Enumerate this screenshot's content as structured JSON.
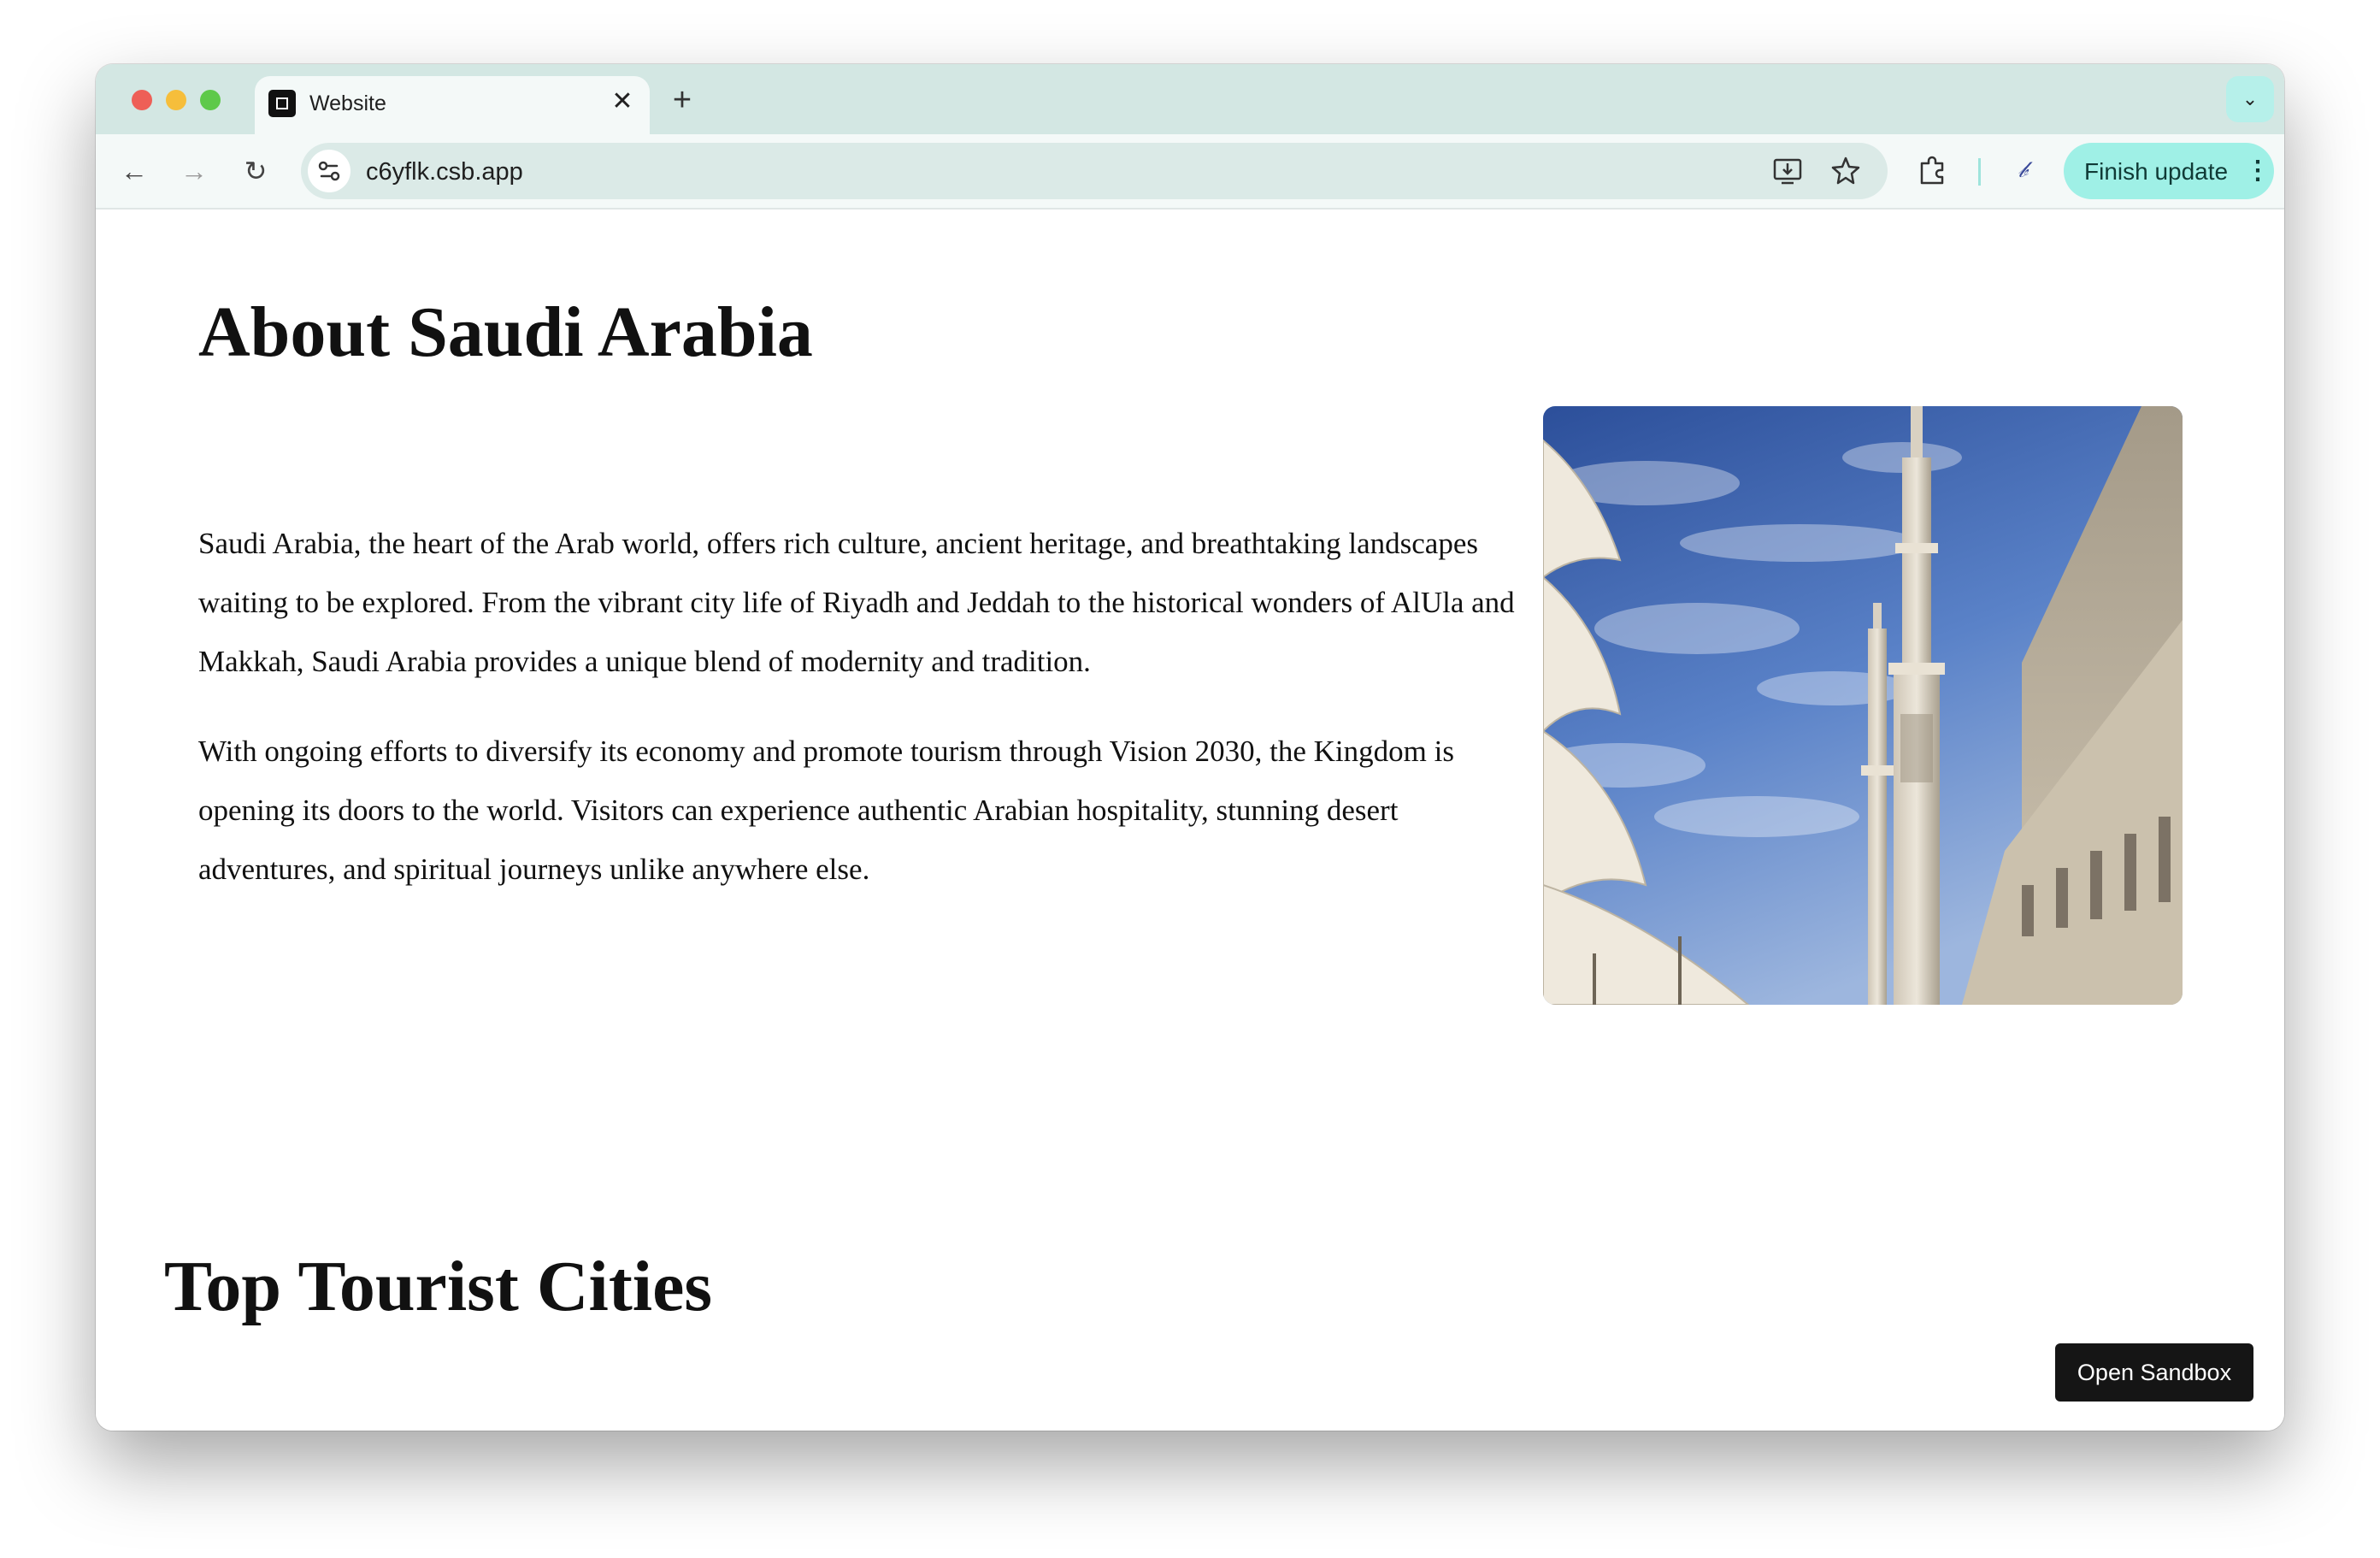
{
  "browser": {
    "tab": {
      "title": "Website",
      "close_glyph": "✕"
    },
    "new_tab_glyph": "+",
    "tab_menu_glyph": "⌄",
    "nav": {
      "back_glyph": "←",
      "forward_glyph": "→",
      "reload_glyph": "↻"
    },
    "url": "c6yflk.csb.app",
    "finish_update_label": "Finish update",
    "menu_glyph": "⋮",
    "icons": {
      "site_info": "site-settings-icon",
      "install": "install-app-icon",
      "bookmark": "bookmark-star-icon",
      "extensions": "extensions-puzzle-icon",
      "profile": "profile-icon"
    }
  },
  "page": {
    "about": {
      "title": "About Saudi Arabia",
      "paragraphs": [
        "Saudi Arabia, the heart of the Arab world, offers rich culture, ancient heritage, and breathtaking landscapes waiting to be explored. From the vibrant city life of Riyadh and Jeddah to the historical wonders of AlUla and Makkah, Saudi Arabia provides a unique blend of modernity and tradition.",
        "With ongoing efforts to diversify its economy and promote tourism through Vision 2030, the Kingdom is opening its doors to the world. Visitors can experience authentic Arabian hospitality, stunning desert adventures, and spiritual journeys unlike anywhere else."
      ]
    },
    "cities": {
      "title": "Top Tourist Cities"
    },
    "open_sandbox_label": "Open Sandbox"
  },
  "colors": {
    "tab_strip": "#d3e7e3",
    "toolbar": "#f4f9f8",
    "omnibox": "#dbeae7",
    "finish_button": "#9ff0e6",
    "sandbox_button": "#151515"
  }
}
